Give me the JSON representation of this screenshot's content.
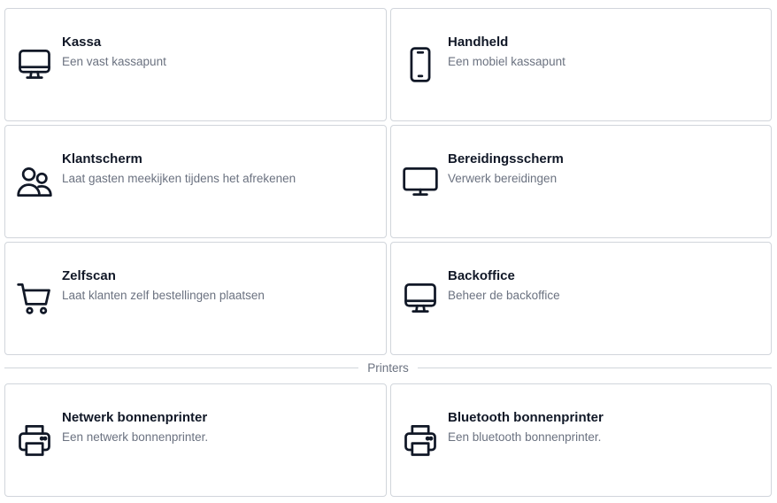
{
  "devices": [
    {
      "title": "Kassa",
      "description": "Een vast kassapunt",
      "icon": "desktop-computer-icon"
    },
    {
      "title": "Handheld",
      "description": "Een mobiel kassapunt",
      "icon": "mobile-phone-icon"
    },
    {
      "title": "Klantscherm",
      "description": "Laat gasten meekijken tijdens het afrekenen",
      "icon": "users-icon"
    },
    {
      "title": "Bereidingsscherm",
      "description": "Verwerk bereidingen",
      "icon": "monitor-icon"
    },
    {
      "title": "Zelfscan",
      "description": "Laat klanten zelf bestellingen plaatsen",
      "icon": "shopping-cart-icon"
    },
    {
      "title": "Backoffice",
      "description": "Beheer de backoffice",
      "icon": "desktop-computer-icon"
    }
  ],
  "printers_section": {
    "label": "Printers"
  },
  "printers": [
    {
      "title": "Netwerk bonnenprinter",
      "description": "Een netwerk bonnenprinter.",
      "icon": "printer-icon"
    },
    {
      "title": "Bluetooth bonnenprinter",
      "description": "Een bluetooth bonnenprinter.",
      "icon": "printer-icon"
    }
  ],
  "colors": {
    "border": "#d1d5db",
    "title": "#111827",
    "description": "#6b7280"
  }
}
